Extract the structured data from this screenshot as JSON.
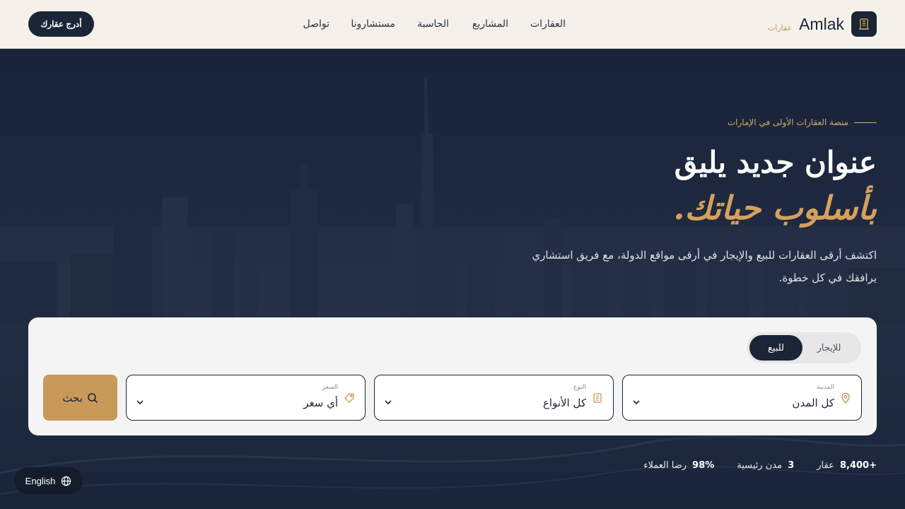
{
  "header": {
    "brand_name": "Amlak",
    "brand_sub": "عقارات",
    "nav": [
      "العقارات",
      "المشاريع",
      "الحاسبة",
      "مستشارونا",
      "تواصل"
    ],
    "list_button": "أدرج عقارك"
  },
  "hero": {
    "eyebrow": "منصة العقارات الأولى في الإمارات",
    "title_line1": "عنوان جديد يليق",
    "title_line2": "بأسلوب حياتك.",
    "desc_line1": "اكتشف أرقى العقارات للبيع والإيجار في أرقى مواقع الدولة، مع فريق استشاري",
    "desc_line2": "يرافقك في كل خطوة."
  },
  "search": {
    "tabs": [
      "للبيع",
      "للإيجار"
    ],
    "active_tab": "للبيع",
    "city": {
      "label": "المدينة",
      "value": "كل المدن"
    },
    "type": {
      "label": "النوع",
      "value": "كل الأنواع"
    },
    "price": {
      "label": "السعر",
      "value": "أي سعر"
    },
    "button": "بحث"
  },
  "stats": [
    {
      "num": "+8,400",
      "label": "عقار"
    },
    {
      "num": "3",
      "label": "مدن رئيسية"
    },
    {
      "num": "98%",
      "label": "رضا العملاء"
    }
  ],
  "language": {
    "label": "English"
  },
  "colors": {
    "navy": "#1b2538",
    "gold": "#c9995a",
    "cream": "#f5f1ea"
  },
  "icons": {
    "brand": "building-icon",
    "city": "map-pin-icon",
    "type": "building-icon",
    "price": "tag-icon",
    "search": "search-icon",
    "lang": "globe-icon"
  }
}
